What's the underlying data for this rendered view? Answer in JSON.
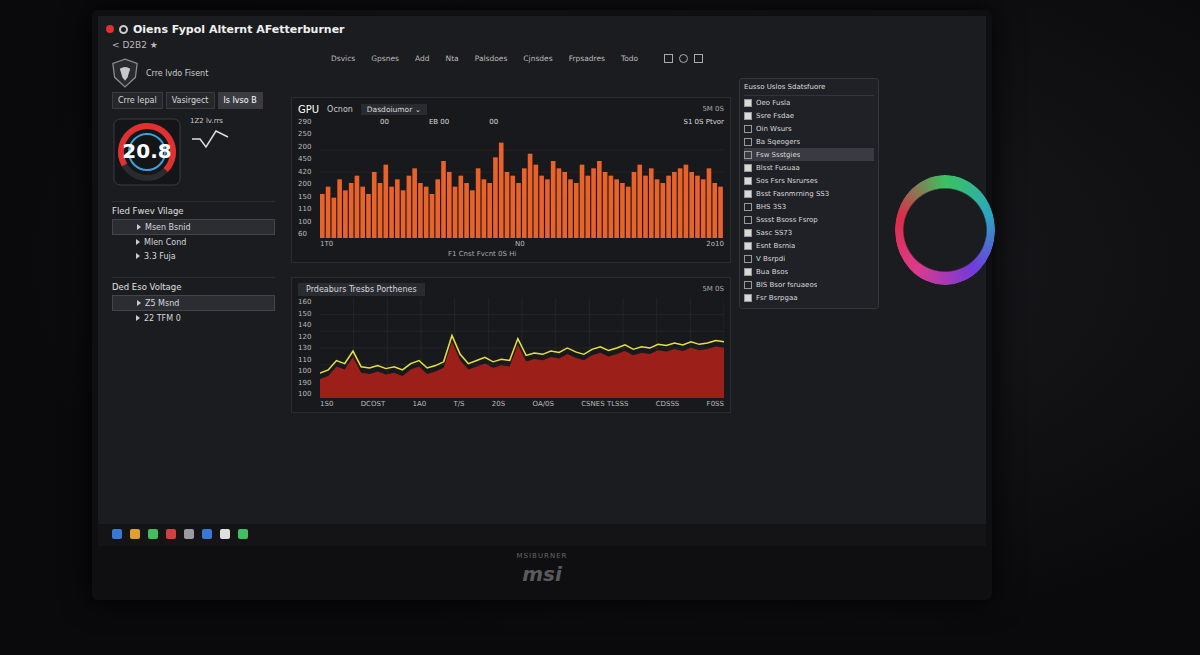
{
  "window": {
    "title": "Oiens Fypol Alternt AFetterburner",
    "subtitle": "< D2B2 ★"
  },
  "profile": {
    "label": "Crre lvdo Fisent"
  },
  "tabs": [
    {
      "label": "Crre lepal",
      "selected": false
    },
    {
      "label": "Vasirgect",
      "selected": false
    },
    {
      "label": "ls Ivso B",
      "selected": true
    }
  ],
  "nav": [
    "Dsvics",
    "Gpsnes",
    "Add",
    "Nta",
    "Palsdoes",
    "Cjnsdes",
    "Frpsadres",
    "Todo"
  ],
  "gauge": {
    "value": "20.8",
    "level": 0.7,
    "note": "1Z2 lv.rrs"
  },
  "sections": [
    {
      "title": "Fled Fwev Vilage",
      "items": [
        {
          "label": "Msen Bsnid",
          "selected": true
        },
        {
          "label": "Mlen Cond",
          "selected": false
        },
        {
          "label": "3.3 Fuja",
          "selected": false
        }
      ]
    },
    {
      "title": "Ded Eso Voltage",
      "items": [
        {
          "label": "Z5 Msnd",
          "selected": true
        },
        {
          "label": "22 TFM 0",
          "selected": false
        }
      ]
    }
  ],
  "chart1": {
    "title": "GPU",
    "series_label": "Ocnon",
    "dropdown": "Dasdoiumor ⌄",
    "corner_note": "5M 0S",
    "notes": [
      "00",
      "EB 00",
      "00"
    ],
    "side_note": "S1 0S Ptvor",
    "y_ticks": [
      "290",
      "250",
      "200",
      "450",
      "420",
      "200",
      "150",
      "110",
      "100",
      "60"
    ],
    "x_ticks": [
      "1T0",
      "N0",
      "2o10"
    ],
    "legend": "F1 Cnst Fvcnt 0S Hi",
    "max": 300,
    "values": [
      120,
      140,
      110,
      160,
      130,
      150,
      170,
      140,
      120,
      180,
      150,
      200,
      140,
      160,
      130,
      170,
      190,
      150,
      140,
      120,
      160,
      210,
      180,
      140,
      170,
      150,
      130,
      190,
      160,
      150,
      220,
      260,
      180,
      170,
      150,
      190,
      230,
      200,
      170,
      160,
      210,
      190,
      180,
      160,
      150,
      200,
      170,
      190,
      210,
      180,
      170,
      160,
      150,
      140,
      180,
      200,
      170,
      190,
      160,
      150,
      170,
      180,
      190,
      200,
      180,
      170,
      160,
      190,
      150,
      140
    ]
  },
  "chart2": {
    "title": "Prdeaburs Tresbs Porthenes",
    "corner_note": "5M 0S",
    "y_ticks": [
      "160",
      "150",
      "140",
      "120",
      "130",
      "110",
      "100",
      "190",
      "100"
    ],
    "x_ticks": [
      "1S0",
      "DCOST",
      "1A0",
      "T/S",
      "20S",
      "OA/0S",
      "CSNES TLSSS",
      "CDSSS",
      "F0SS"
    ],
    "max": 160,
    "values": [
      40,
      45,
      60,
      55,
      75,
      50,
      48,
      52,
      47,
      50,
      45,
      55,
      60,
      48,
      52,
      58,
      100,
      70,
      55,
      60,
      65,
      58,
      62,
      60,
      95,
      68,
      72,
      70,
      75,
      73,
      80,
      74,
      70,
      78,
      82,
      76,
      80,
      85,
      78,
      82,
      80,
      86,
      84,
      88,
      85,
      90,
      86,
      88,
      92,
      90
    ]
  },
  "panel": {
    "title": "Eusso Uslos Sdatsfuore",
    "items": [
      {
        "label": "Oeo Fusla",
        "checked": true,
        "selected": false
      },
      {
        "label": "Ssre Fsdae",
        "checked": true,
        "selected": false
      },
      {
        "label": "Oin Wsurs",
        "checked": false,
        "selected": false
      },
      {
        "label": "Ba Sqeogers",
        "checked": false,
        "selected": false
      },
      {
        "label": "Fsw Ssstgies",
        "checked": false,
        "selected": true
      },
      {
        "label": "Blsst Fusuaa",
        "checked": true,
        "selected": false
      },
      {
        "label": "Sos Fsrs Nsrurses",
        "checked": true,
        "selected": false
      },
      {
        "label": "Bsst Fasnmrning SS3",
        "checked": true,
        "selected": false
      },
      {
        "label": "BHS 3S3",
        "checked": false,
        "selected": false
      },
      {
        "label": "Sssst Bsoss Fsrop",
        "checked": false,
        "selected": false
      },
      {
        "label": "Sasc SS73",
        "checked": true,
        "selected": false
      },
      {
        "label": "Esnt Bsrnia",
        "checked": true,
        "selected": false
      },
      {
        "label": "V Bsrpdi",
        "checked": false,
        "selected": false
      },
      {
        "label": "Bua Bsos",
        "checked": true,
        "selected": false
      },
      {
        "label": "BIS Bsor fsruaeos",
        "checked": false,
        "selected": false
      },
      {
        "label": "Fsr Bsrpgaa",
        "checked": true,
        "selected": false
      }
    ]
  },
  "taskbar": [
    {
      "color": "#3a78d6"
    },
    {
      "color": "#e0a030"
    },
    {
      "color": "#3fbf5f"
    },
    {
      "color": "#d04040"
    },
    {
      "color": "#9a9aa0"
    },
    {
      "color": "#3a78d6"
    },
    {
      "color": "#e0e0e0"
    },
    {
      "color": "#3fbf5f"
    }
  ],
  "bezel_label": "MSIBURNER",
  "brand": "msi"
}
